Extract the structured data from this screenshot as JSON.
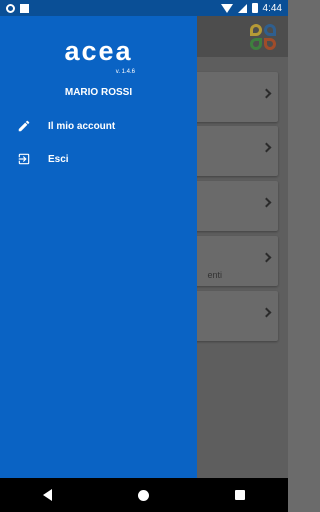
{
  "status_bar": {
    "time": "4:44"
  },
  "brand": {
    "logo_text": "acea",
    "version": "v. 1.4.6"
  },
  "user": {
    "name": "MARIO ROSSI"
  },
  "menu": [
    {
      "label": "Il mio account",
      "icon": "pencil-icon"
    },
    {
      "label": "Esci",
      "icon": "exit-icon"
    }
  ],
  "background": {
    "card_partial_text": "enti"
  },
  "colors": {
    "drawer": "#0a63c4",
    "status_bar": "#0a4f96"
  }
}
